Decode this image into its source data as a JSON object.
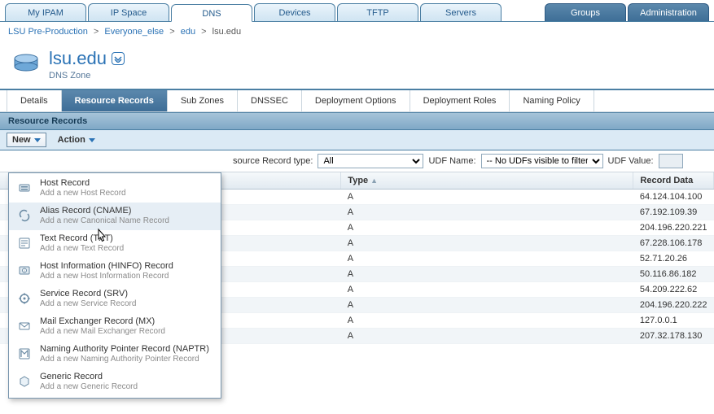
{
  "top_tabs": {
    "my_ipam": "My IPAM",
    "ip_space": "IP Space",
    "dns": "DNS",
    "devices": "Devices",
    "tftp": "TFTP",
    "servers": "Servers",
    "groups": "Groups",
    "administration": "Administration"
  },
  "breadcrumb": {
    "root": "LSU Pre-Production",
    "seg2": "Everyone_else",
    "seg3": "edu",
    "current": "lsu.edu"
  },
  "title": {
    "main": "lsu.edu",
    "sub": "DNS Zone"
  },
  "sub_tabs": {
    "details": "Details",
    "resource_records": "Resource Records",
    "sub_zones": "Sub Zones",
    "dnssec": "DNSSEC",
    "deployment_options": "Deployment Options",
    "deployment_roles": "Deployment Roles",
    "naming_policy": "Naming Policy"
  },
  "panel": {
    "header": "Resource Records"
  },
  "toolbar": {
    "new_label": "New",
    "action_label": "Action"
  },
  "filter": {
    "type_label": "source Record type:",
    "type_selected": "All",
    "udf_name_label": "UDF Name:",
    "udf_name_selected": "-- No UDFs visible to filter",
    "udf_value_label": "UDF Value:",
    "udf_value": ""
  },
  "columns": {
    "name": "",
    "type": "Type",
    "record_data": "Record Data"
  },
  "rows": [
    {
      "type": "A",
      "data": "64.124.104.100"
    },
    {
      "type": "A",
      "data": "67.192.109.39"
    },
    {
      "type": "A",
      "data": "204.196.220.221"
    },
    {
      "type": "A",
      "data": "67.228.106.178"
    },
    {
      "type": "A",
      "data": "52.71.20.26"
    },
    {
      "type": "A",
      "data": "50.116.86.182"
    },
    {
      "type": "A",
      "data": "54.209.222.62"
    },
    {
      "type": "A",
      "data": "204.196.220.222"
    },
    {
      "type": "A",
      "data": "127.0.0.1"
    },
    {
      "type": "A",
      "data": "207.32.178.130"
    }
  ],
  "new_menu": [
    {
      "title": "Host Record",
      "desc": "Add a new Host Record",
      "icon": "host"
    },
    {
      "title": "Alias Record (CNAME)",
      "desc": "Add a new Canonical Name Record",
      "icon": "alias",
      "hover": true
    },
    {
      "title": "Text Record (TXT)",
      "desc": "Add a new Text Record",
      "icon": "text"
    },
    {
      "title": "Host Information (HINFO) Record",
      "desc": "Add a new Host Information Record",
      "icon": "hinfo"
    },
    {
      "title": "Service Record (SRV)",
      "desc": "Add a new Service Record",
      "icon": "srv"
    },
    {
      "title": "Mail Exchanger Record (MX)",
      "desc": "Add a new Mail Exchanger Record",
      "icon": "mx"
    },
    {
      "title": "Naming Authority Pointer Record (NAPTR)",
      "desc": "Add a new Naming Authority Pointer Record",
      "icon": "naptr"
    },
    {
      "title": "Generic Record",
      "desc": "Add a new Generic Record",
      "icon": "generic"
    }
  ]
}
